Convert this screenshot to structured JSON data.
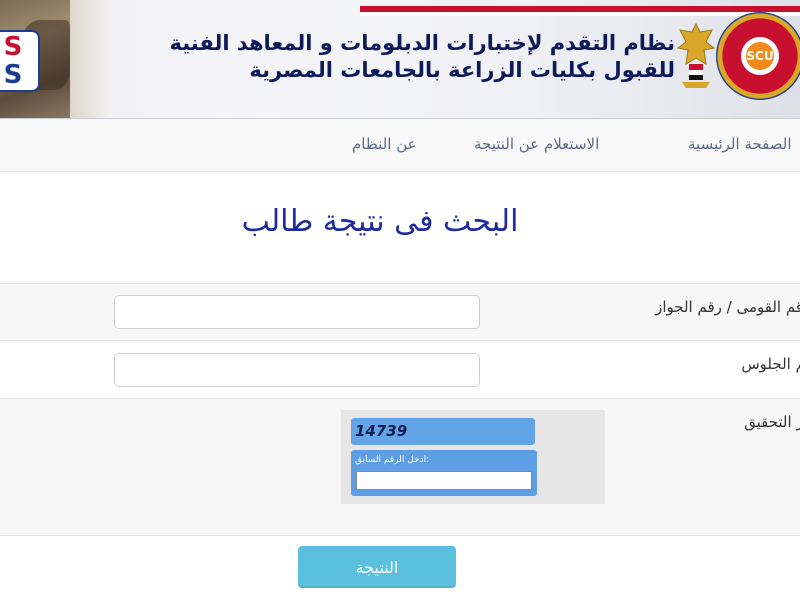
{
  "banner": {
    "title_line1": "نظام التقدم لإختبارات الدبلومات و المعاهد الفنية",
    "title_line2": "للقبول بكليات الزراعة بالجامعات المصرية",
    "left_logo_text_top": "S",
    "left_logo_text_bottom": "S",
    "right_logo_text": "SCU"
  },
  "nav": {
    "items": [
      {
        "label": "الصفحة الرئيسية"
      },
      {
        "label": "الاستعلام عن النتيجة"
      },
      {
        "label": "عن النظام"
      }
    ]
  },
  "main": {
    "heading": "البحث فى نتيجة طالب"
  },
  "form": {
    "national_id_label": "الرقم القومى / رقم الجواز",
    "national_id_value": "",
    "seat_number_label": "رقم الجلوس",
    "seat_number_value": "",
    "captcha_label": "رمز التحقيق",
    "captcha_code": "14739",
    "captcha_prompt": ":ادخل الرقم السابق",
    "captcha_value": ""
  },
  "actions": {
    "submit_label": "النتيجة"
  },
  "colors": {
    "heading": "#1e2aa0",
    "nav_text": "#5a6b86",
    "captcha_blue": "#5d9ee4",
    "submit_button": "#5bc0de"
  }
}
